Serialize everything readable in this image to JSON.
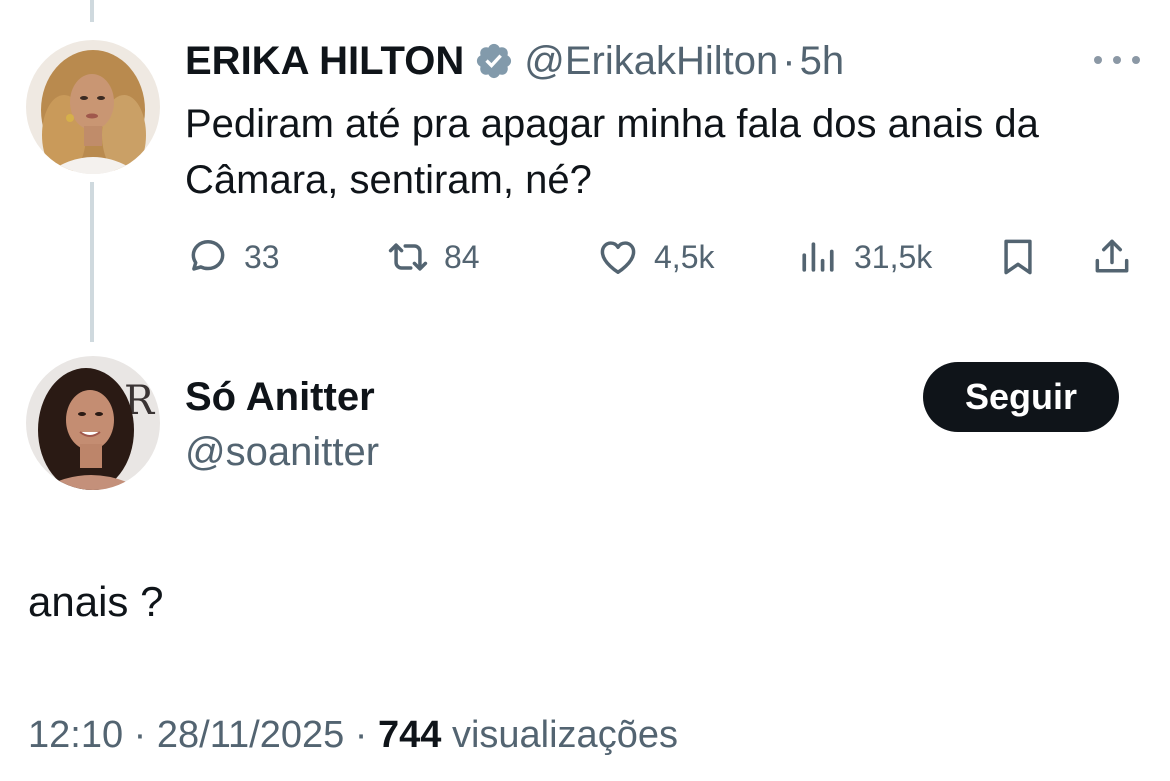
{
  "original_tweet": {
    "author_name": "ERIKA HILTON",
    "verified_icon": "verified-badge-icon",
    "handle": "@ErikakHilton",
    "separator": "·",
    "time": "5h",
    "text": "Pediram até pra apagar minha fala dos anais da Câmara, sentiram, né?",
    "actions": {
      "replies": "33",
      "retweets": "84",
      "likes": "4,5k",
      "views": "31,5k"
    }
  },
  "reply_tweet": {
    "author_name": "Só Anitter",
    "handle": "@soanitter",
    "follow_label": "Seguir",
    "text": "anais ?",
    "timestamp": "12:10 · 28/11/2025 · ",
    "views_count": "744",
    "views_label": " visualizações"
  },
  "colors": {
    "text_primary": "#0f1419",
    "text_secondary": "#536471",
    "verified": "#829aab",
    "thread_line": "#cfd9de",
    "follow_bg": "#0f1419"
  }
}
